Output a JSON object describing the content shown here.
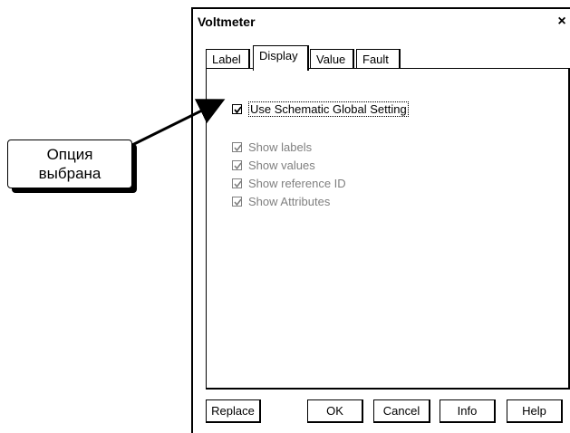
{
  "dialog": {
    "title": "Voltmeter",
    "close_glyph": "×"
  },
  "tabs": [
    {
      "label": "Label"
    },
    {
      "label": "Display"
    },
    {
      "label": "Value"
    },
    {
      "label": "Fault"
    }
  ],
  "options": {
    "global": {
      "label": "Use Schematic Global Setting",
      "checked": true
    },
    "items": [
      {
        "label": "Show labels",
        "checked": true,
        "enabled": false
      },
      {
        "label": "Show values",
        "checked": true,
        "enabled": false
      },
      {
        "label": "Show reference ID",
        "checked": true,
        "enabled": false
      },
      {
        "label": "Show Attributes",
        "checked": true,
        "enabled": false
      }
    ]
  },
  "buttons": {
    "replace": "Replace",
    "ok": "OK",
    "cancel": "Cancel",
    "info": "Info",
    "help": "Help"
  },
  "callout": {
    "line1": "Опция",
    "line2": "выбрана"
  }
}
